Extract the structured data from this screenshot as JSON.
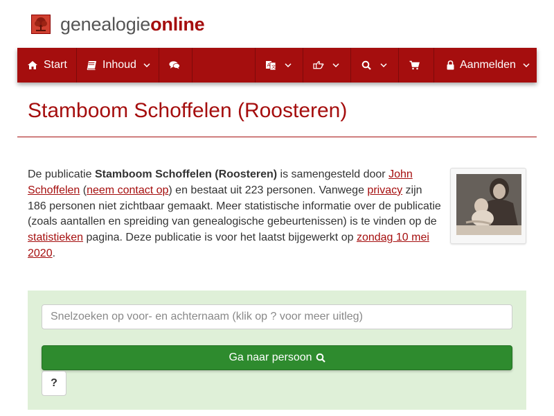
{
  "site": {
    "logo_icon": "tree-icon",
    "name_light": "genealogie",
    "name_bold": "online",
    "brand_color": "#a50e0e"
  },
  "nav": {
    "start_label": "Start",
    "inhoud_label": "Inhoud",
    "aanmelden_label": "Aanmelden",
    "icons": [
      "home-icon",
      "book-icon",
      "comments-icon",
      "language-icon",
      "hand-pointer-icon",
      "search-icon",
      "cart-icon",
      "lock-icon"
    ]
  },
  "page": {
    "title": "Stamboom Schoffelen (Roosteren)"
  },
  "intro": {
    "t1": "De publicatie ",
    "pub_name": "Stamboom Schoffelen (Roosteren)",
    "t2": " is samengesteld door ",
    "author_link": "John Schoffelen",
    "t3": " (",
    "contact_link": "neem contact op",
    "t4": ") en bestaat uit 223 personen. Vanwege ",
    "privacy_link": "privacy",
    "t5": " zijn 186 personen niet zichtbaar gemaakt. Meer statistische informatie over de publicatie (zoals aantallen en spreiding van genealogische gebeurtenissen) is te vinden op de ",
    "stats_link": "statistieken",
    "t6": " pagina. Deze publicatie is voor het laatst bijgewerkt op ",
    "date_link": "zondag 10 mei 2020",
    "t7": "."
  },
  "search": {
    "placeholder": "Snelzoeken op voor- en achternaam (klik op ? voor meer uitleg)",
    "value": "",
    "go_label": "Ga naar persoon",
    "help_label": "?",
    "panel_color": "#dff0d8",
    "button_color": "#2e8b2e"
  }
}
